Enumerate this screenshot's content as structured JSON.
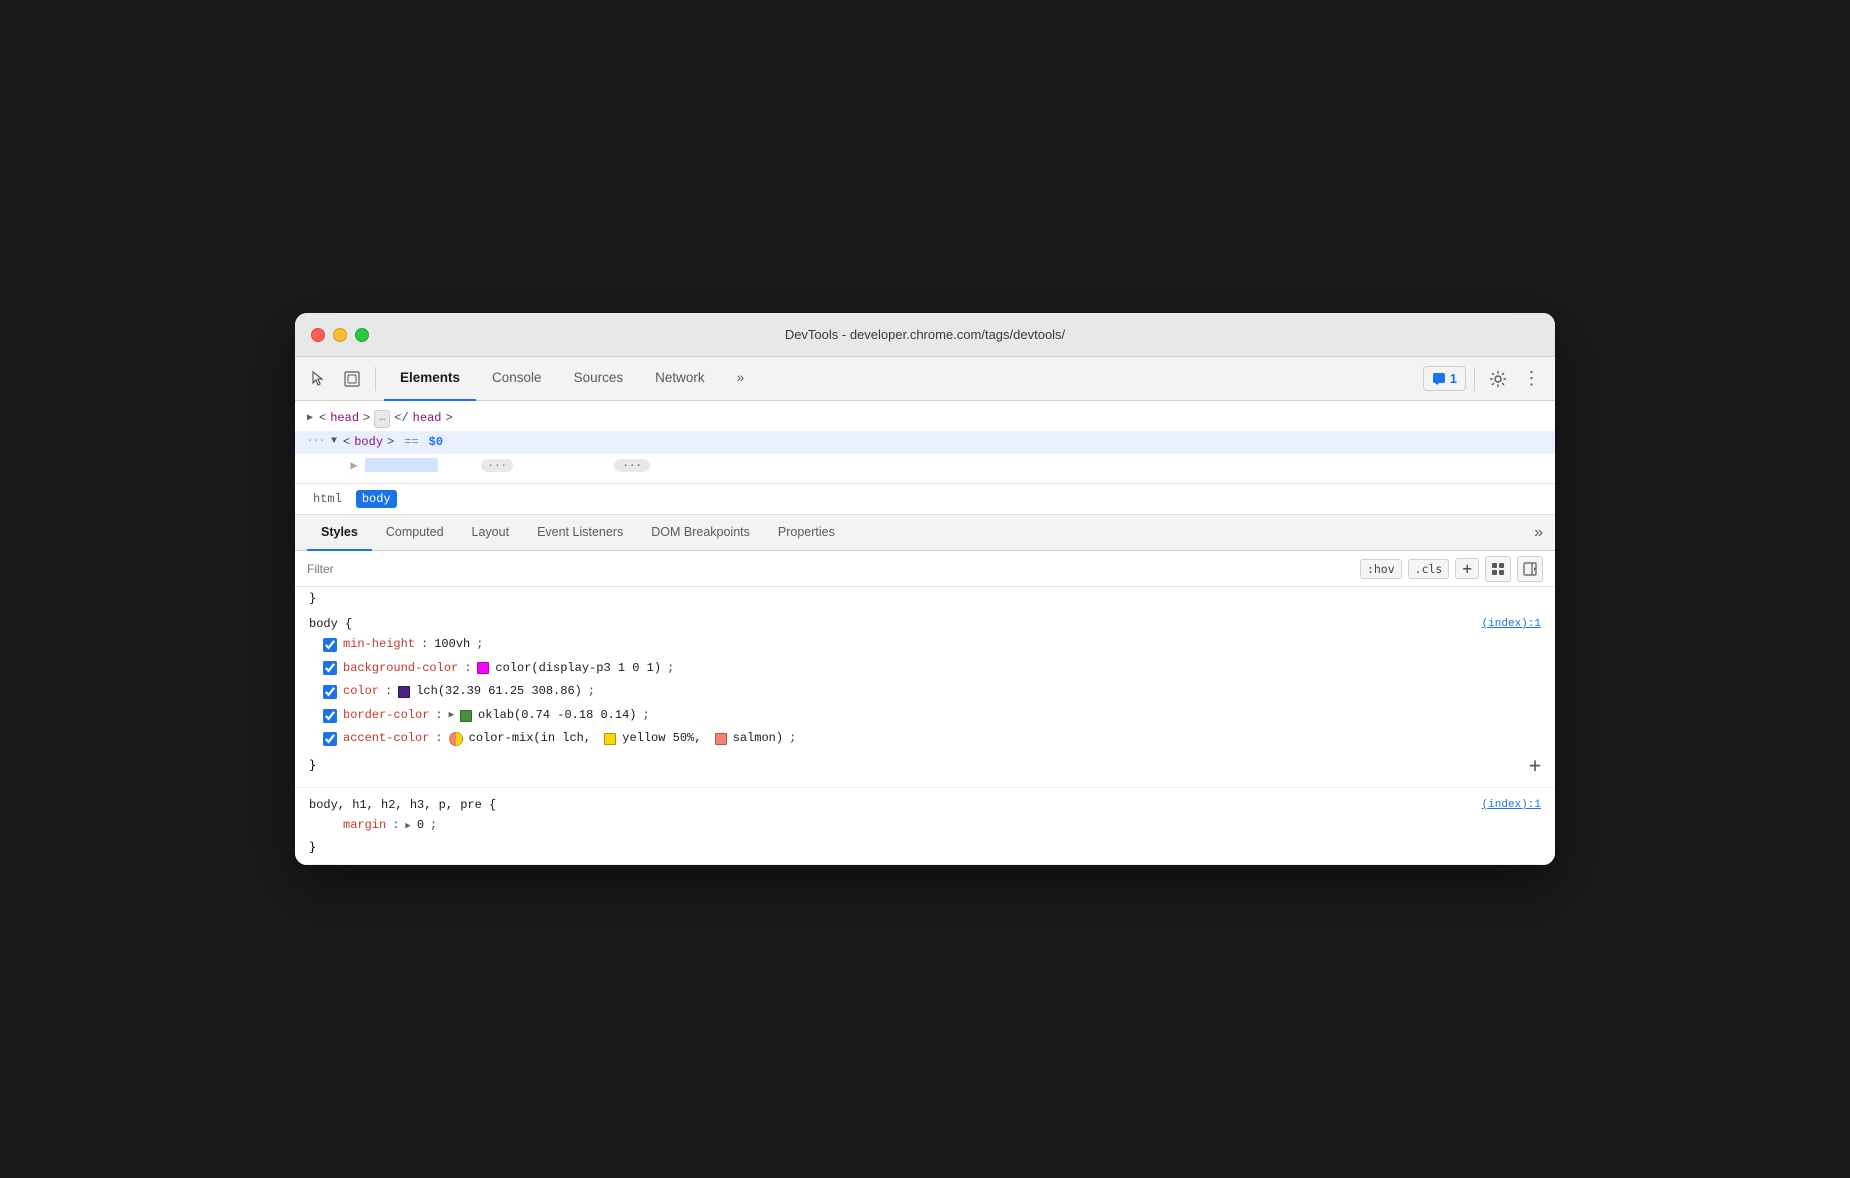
{
  "window": {
    "title": "DevTools - developer.chrome.com/tags/devtools/"
  },
  "toolbar": {
    "tabs": [
      {
        "id": "elements",
        "label": "Elements",
        "active": true
      },
      {
        "id": "console",
        "label": "Console",
        "active": false
      },
      {
        "id": "sources",
        "label": "Sources",
        "active": false
      },
      {
        "id": "network",
        "label": "Network",
        "active": false
      },
      {
        "id": "more",
        "label": "»",
        "active": false
      }
    ],
    "badge_label": "1",
    "cursor_icon": "⬆",
    "inspect_icon": "⬜"
  },
  "elements_panel": {
    "lines": [
      {
        "id": "head-line",
        "indent": 0,
        "content": "▶ <head> … </head>"
      },
      {
        "id": "body-line",
        "indent": 0,
        "content": "··· ▼ <body> == $0",
        "selected": true
      }
    ],
    "truncated_line": "▶ ···"
  },
  "breadcrumb": {
    "items": [
      {
        "id": "html-crumb",
        "label": "html",
        "active": false
      },
      {
        "id": "body-crumb",
        "label": "body",
        "active": true
      }
    ]
  },
  "styles_tabs": {
    "tabs": [
      {
        "id": "styles-tab",
        "label": "Styles",
        "active": true
      },
      {
        "id": "computed-tab",
        "label": "Computed",
        "active": false
      },
      {
        "id": "layout-tab",
        "label": "Layout",
        "active": false
      },
      {
        "id": "event-listeners-tab",
        "label": "Event Listeners",
        "active": false
      },
      {
        "id": "dom-breakpoints-tab",
        "label": "DOM Breakpoints",
        "active": false
      },
      {
        "id": "properties-tab",
        "label": "Properties",
        "active": false
      }
    ],
    "more_label": "»"
  },
  "filter_bar": {
    "placeholder": "Filter",
    "hov_btn": ":hov",
    "cls_btn": ".cls",
    "add_btn": "+",
    "force_btn": "⊞",
    "layout_btn": "◀"
  },
  "styles_rules": [
    {
      "id": "rule-closing",
      "type": "closing",
      "content": "}"
    },
    {
      "id": "rule-body",
      "selector": "body {",
      "source": "(index):1",
      "properties": [
        {
          "id": "prop-min-height",
          "checked": true,
          "name": "min-height",
          "value": "100vh",
          "swatch": null,
          "swatch_color": null
        },
        {
          "id": "prop-bg-color",
          "checked": true,
          "name": "background-color",
          "value": "color(display-p3 1 0 1)",
          "swatch": "solid",
          "swatch_color": "#ff00ff"
        },
        {
          "id": "prop-color",
          "checked": true,
          "name": "color",
          "value": "lch(32.39 61.25 308.86)",
          "swatch": "solid",
          "swatch_color": "#4a2080"
        },
        {
          "id": "prop-border-color",
          "checked": true,
          "name": "border-color",
          "value": "oklab(0.74 -0.18 0.14)",
          "swatch": "arrow-solid",
          "swatch_color": "#4a9040"
        },
        {
          "id": "prop-accent-color",
          "checked": true,
          "name": "accent-color",
          "value": "color-mix(in lch,",
          "value2": "yellow 50%,",
          "value3": "salmon)",
          "swatch": "mixed"
        }
      ],
      "closing": "}"
    },
    {
      "id": "rule-body-headings",
      "selector": "body, h1, h2, h3, p, pre {",
      "source": "(index):1",
      "properties": [
        {
          "id": "prop-margin",
          "checked": false,
          "name": "margin",
          "value": "0",
          "has_arrow": true
        }
      ],
      "closing": "}"
    }
  ],
  "colors": {
    "accent_blue": "#1a73e8",
    "property_red": "#c0392b",
    "tag_purple": "#881280"
  }
}
